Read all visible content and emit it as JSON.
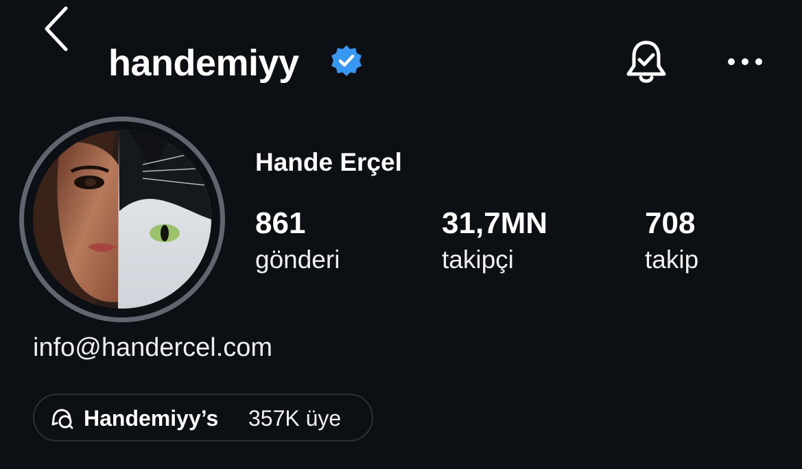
{
  "header": {
    "username": "handemiyy",
    "back_icon": "chevron-left-icon",
    "verified_icon": "verified-badge-icon",
    "verified_color": "#3897f0",
    "notification_icon": "bell-check-icon",
    "more_icon": "more-horizontal-icon"
  },
  "profile": {
    "full_name": "Hande Erçel",
    "avatar": "profile-avatar",
    "stats": [
      {
        "value": "861",
        "label": "gönderi"
      },
      {
        "value": "31,7MN",
        "label": "takipçi"
      },
      {
        "value": "708",
        "label": "takip"
      }
    ],
    "bio_email": "info@handercel.com"
  },
  "channel": {
    "icon": "broadcast-chat-icon",
    "name": "Handemiyy’s",
    "members": "357K üye"
  },
  "colors": {
    "background": "#0c1014",
    "text": "#ffffff",
    "ring": "#5f6670",
    "pill_border": "#2c3138"
  }
}
